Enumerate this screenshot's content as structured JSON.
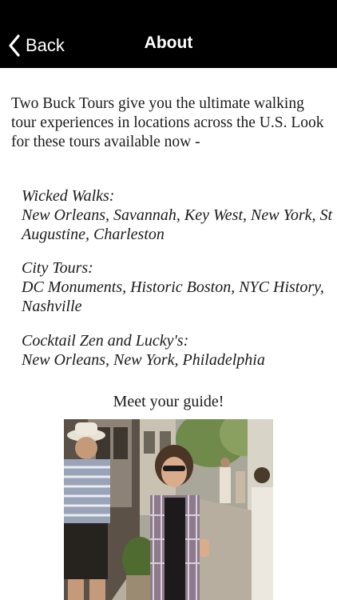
{
  "navbar": {
    "back_label": "Back",
    "title": "About",
    "background": "#000000",
    "text_color": "#ffffff",
    "back_icon": "chevron-left-icon"
  },
  "intro": "Two Buck Tours give you the ultimate walking tour experiences in locations across the U.S. Look for these tours available now -",
  "tours": [
    {
      "title": "Wicked Walks:",
      "cities": "New Orleans, Savannah, Key West, New York, St Augustine, Charleston"
    },
    {
      "title": "City Tours:",
      "cities": "DC Monuments, Historic Boston, NYC History, Nashville"
    },
    {
      "title": "Cocktail Zen and Lucky's:",
      "cities": "New Orleans, New York, Philadelphia"
    }
  ],
  "meet_guide": "Meet your guide!"
}
